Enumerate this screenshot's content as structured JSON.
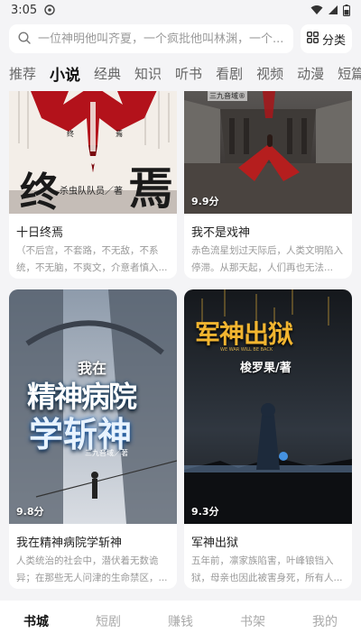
{
  "status_bar": {
    "time": "3:05"
  },
  "search": {
    "placeholder": "一位神明他叫齐夏，一个疯批他叫林渊，一个..."
  },
  "category": {
    "label": "分类"
  },
  "tabs": [
    {
      "label": "推荐",
      "active": false
    },
    {
      "label": "小说",
      "active": true
    },
    {
      "label": "经典",
      "active": false
    },
    {
      "label": "知识",
      "active": false
    },
    {
      "label": "听书",
      "active": false
    },
    {
      "label": "看剧",
      "active": false
    },
    {
      "label": "视频",
      "active": false
    },
    {
      "label": "动漫",
      "active": false
    },
    {
      "label": "短篇",
      "active": false
    }
  ],
  "books": [
    {
      "title": "十日终焉",
      "desc": "（不后宫，不套路，不无敌，不系统，不无脑，不爽文，介意者慎入...",
      "cover_text": {
        "big_left": "终",
        "big_right": "焉",
        "author_line": "杀虫队队员／著",
        "small_top_left": "终",
        "small_top_right": "焉"
      }
    },
    {
      "title": "我不是戏神",
      "desc": "赤色流星划过天际后，人类文明陷入停滞。从那天起，人们再也无法...",
      "score": "9.9分",
      "cover_text": {
        "logo": "三九音域®"
      }
    },
    {
      "title": "我在精神病院学斩神",
      "desc": "人类统治的社会中，潜伏着无数诡异；在那些无人问津的生命禁区，...",
      "score": "9.8分",
      "cover_text": {
        "top": "我在",
        "line1": "精神病院",
        "line2": "学斩神",
        "logo": "三九音域／著"
      }
    },
    {
      "title": "军神出狱",
      "desc": "五年前，凛家族陷害，叶峰锒铛入狱，母亲也因此被害身死，所有人...",
      "score": "9.3分",
      "cover_text": {
        "title": "军神出狱",
        "sub": "WE WAR WILL BE BACK",
        "author": "梭罗果/著"
      }
    }
  ],
  "bottom_nav": [
    {
      "label": "书城",
      "active": true
    },
    {
      "label": "短剧",
      "active": false
    },
    {
      "label": "赚钱",
      "active": false
    },
    {
      "label": "书架",
      "active": false
    },
    {
      "label": "我的",
      "active": false
    }
  ]
}
